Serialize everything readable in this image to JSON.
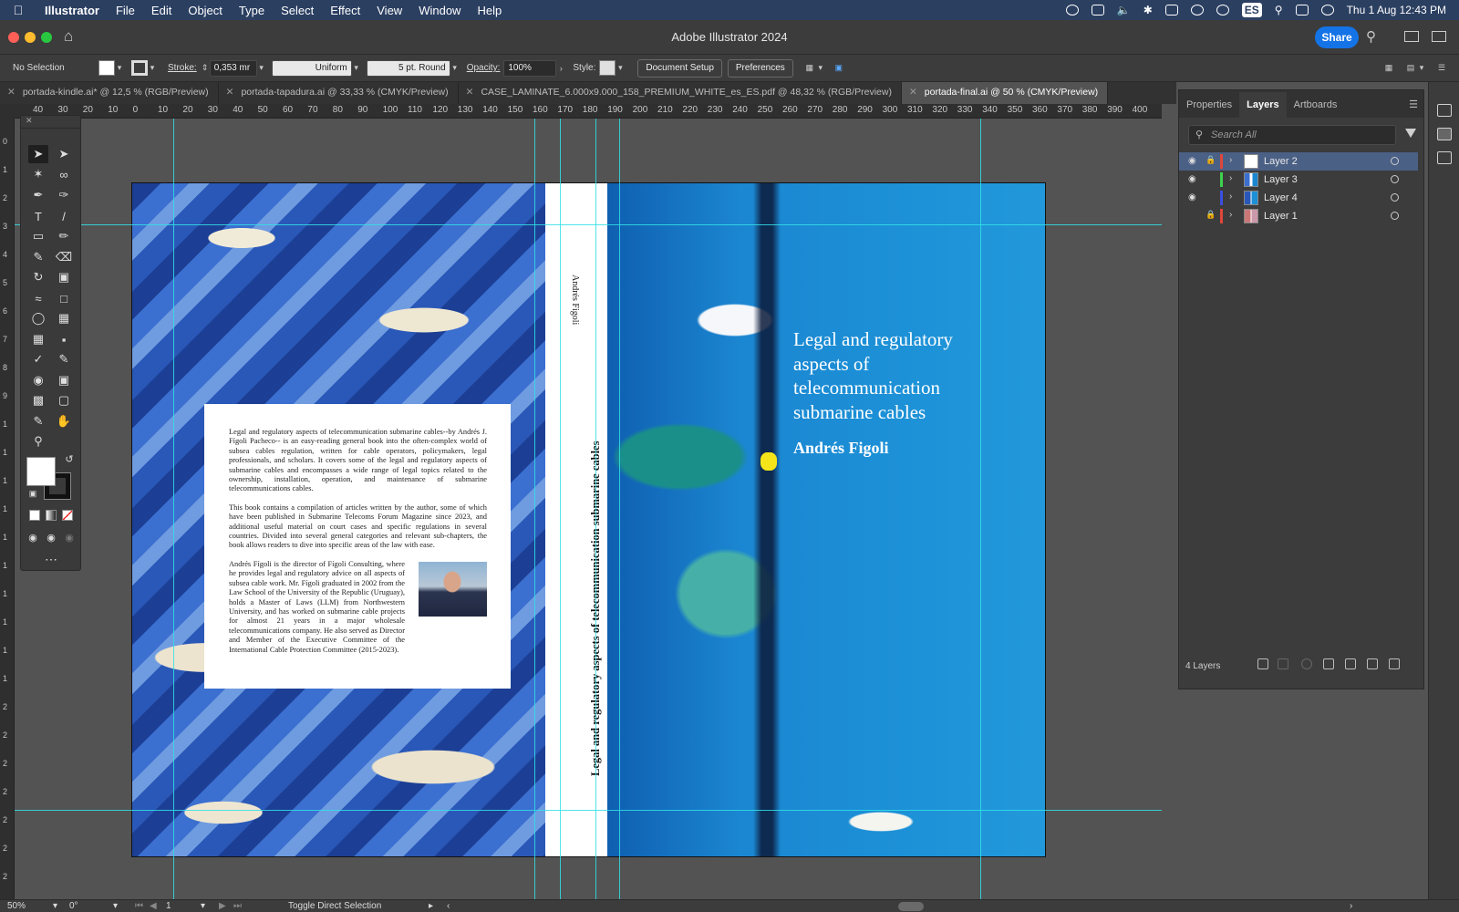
{
  "menubar": {
    "app": "Illustrator",
    "items": [
      "File",
      "Edit",
      "Object",
      "Type",
      "Select",
      "Effect",
      "View",
      "Window",
      "Help"
    ],
    "lang_badge": "ES",
    "clock": "Thu 1 Aug  12:43 PM"
  },
  "titlebar": {
    "title": "Adobe Illustrator 2024",
    "share_label": "Share"
  },
  "controlbar": {
    "selection": "No Selection",
    "stroke_label": "Stroke:",
    "stroke_value": "0,353 mr",
    "profile": "Uniform",
    "brush": "5 pt. Round",
    "opacity_label": "Opacity:",
    "opacity_value": "100%",
    "style_label": "Style:",
    "doc_setup": "Document Setup",
    "preferences": "Preferences"
  },
  "tabs": [
    {
      "label": "portada-kindle.ai* @ 12,5 % (RGB/Preview)",
      "active": false
    },
    {
      "label": "portada-tapadura.ai @ 33,33 % (CMYK/Preview)",
      "active": false
    },
    {
      "label": "CASE_LAMINATE_6.000x9.000_158_PREMIUM_WHITE_es_ES.pdf @ 48,32 % (RGB/Preview)",
      "active": false
    },
    {
      "label": "portada-final.ai @ 50 % (CMYK/Preview)",
      "active": true
    }
  ],
  "ruler": {
    "top_labels": [
      "40",
      "30",
      "20",
      "10",
      "0",
      "10",
      "20",
      "30",
      "40",
      "50",
      "60",
      "70",
      "80",
      "90",
      "100",
      "110",
      "120",
      "130",
      "140",
      "150",
      "160",
      "170",
      "180",
      "190",
      "200",
      "210",
      "220",
      "230",
      "240",
      "250",
      "260",
      "270",
      "280",
      "290",
      "300",
      "310",
      "320",
      "330",
      "340",
      "350",
      "360",
      "370",
      "380",
      "390",
      "400"
    ],
    "left_labels": [
      "0",
      "1",
      "2",
      "3",
      "4",
      "5",
      "6",
      "7",
      "8",
      "9",
      "1",
      "1",
      "1",
      "1",
      "1",
      "1",
      "1",
      "1",
      "1",
      "1",
      "2",
      "2",
      "2",
      "2",
      "2",
      "2",
      "2"
    ]
  },
  "artwork": {
    "front_title": "Legal and regulatory aspects of telecommunication submarine cables",
    "front_author": "Andrés Figoli",
    "spine_author": "Andrés Figoli",
    "spine_title": "Legal and regulatory aspects of telecommunication submarine cables",
    "blurb_p1": "Legal and regulatory aspects of telecommunication submarine cables--by Andrés J. Fígoli Pacheco-- is an easy-reading general book into the often-complex world of subsea cables regulation, written for cable operators, policymakers, legal professionals, and scholars. It covers some of the legal and regulatory aspects of submarine cables and encompasses a wide range of legal topics related to the ownership, installation, operation, and maintenance of submarine telecommunications cables.",
    "blurb_p2": "This book contains a compilation of articles written by the author, some of which have been published in Submarine Telecoms Forum Magazine since 2023, and additional useful material on court cases and specific regulations in several countries. Divided into several general categories and relevant sub-chapters, the book allows readers to dive into specific areas of the law with ease.",
    "blurb_p3": "Andrés Fígoli is the director of Fígoli Consulting, where he provides legal and regulatory advice on all aspects of subsea cable work. Mr. Fígoli graduated in 2002 from the Law School of the University of the Republic (Uruguay), holds a Master of Laws (LLM) from Northwestern University, and has worked on submarine cable projects for almost 21 years in a major wholesale telecommunications company. He also served as Director and Member of the Executive Committee of the International Cable Protection Committee (2015-2023)."
  },
  "layers_panel": {
    "tabs": [
      "Properties",
      "Layers",
      "Artboards"
    ],
    "search_placeholder": "Search All",
    "layers": [
      {
        "name": "Layer 2",
        "visible": true,
        "locked": true,
        "color": "#e0463a",
        "selected": true
      },
      {
        "name": "Layer 3",
        "visible": true,
        "locked": false,
        "color": "#3ed14a",
        "selected": false
      },
      {
        "name": "Layer 4",
        "visible": true,
        "locked": false,
        "color": "#3a4fe0",
        "selected": false
      },
      {
        "name": "Layer 1",
        "visible": false,
        "locked": true,
        "color": "#e0463a",
        "selected": false
      }
    ],
    "count": "4 Layers"
  },
  "statusbar": {
    "zoom": "50%",
    "rotation": "0°",
    "artboard": "1",
    "tool": "Toggle Direct Selection"
  }
}
